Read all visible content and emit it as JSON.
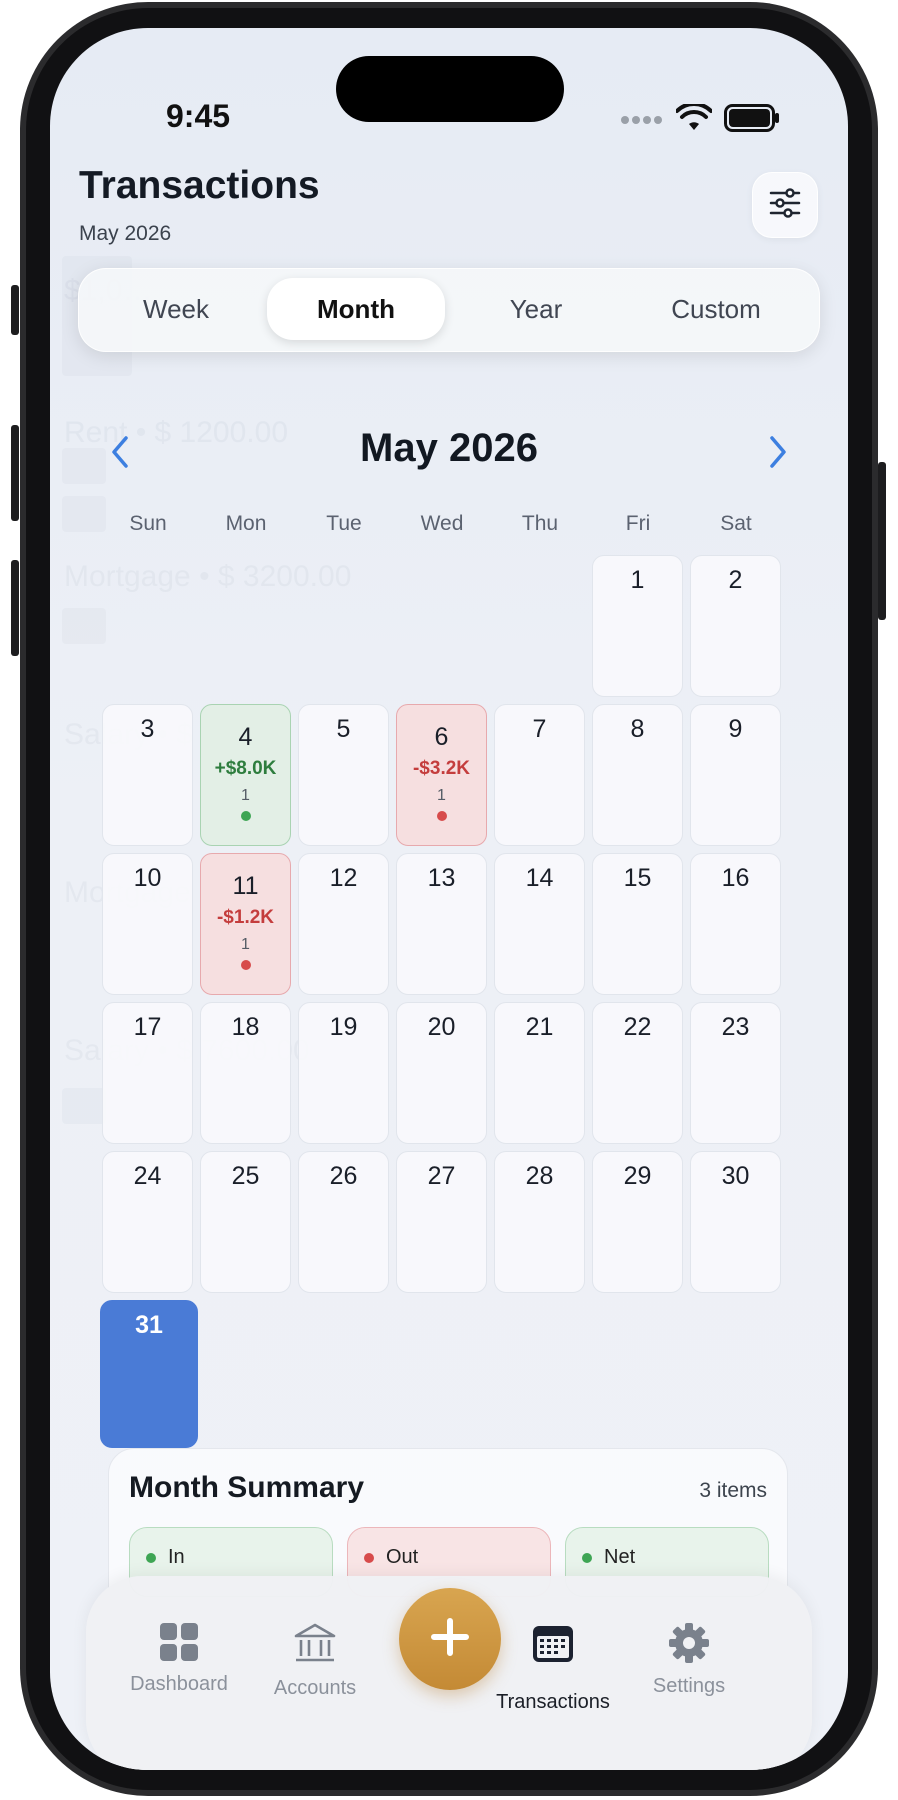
{
  "status_bar": {
    "time": "9:45"
  },
  "header": {
    "title": "Transactions",
    "subtitle": "May 2026"
  },
  "period_tabs": [
    {
      "label": "Week",
      "active": false
    },
    {
      "label": "Month",
      "active": true
    },
    {
      "label": "Year",
      "active": false
    },
    {
      "label": "Custom",
      "active": false
    }
  ],
  "background_ghost_text": [
    "$1,0…",
    "Rent • $ 1200.00",
    "Mortgage • $ 3200.00",
    "Salary • $",
    "Mortgage • $",
    "Salary • $ 7600.00"
  ],
  "calendar": {
    "title": "May 2026",
    "weekdays": [
      "Sun",
      "Mon",
      "Tue",
      "Wed",
      "Thu",
      "Fri",
      "Sat"
    ],
    "first_weekday_index": 5,
    "days_in_month": 31,
    "today": 31,
    "highlighted_days": {
      "4": {
        "type": "income",
        "amount": "+$8.0K",
        "count": "1"
      },
      "6": {
        "type": "expense",
        "amount": "-$3.2K",
        "count": "1"
      },
      "11": {
        "type": "expense",
        "amount": "-$1.2K",
        "count": "1"
      }
    }
  },
  "month_summary": {
    "title": "Month Summary",
    "count": "3 items",
    "chips": [
      {
        "label": "In",
        "color": "#3ea554",
        "bg": "#e8f3eb",
        "border": "#b8dcc0"
      },
      {
        "label": "Out",
        "color": "#d74b4b",
        "bg": "#f8e4e5",
        "border": "#ecb6ba"
      },
      {
        "label": "Net",
        "color": "#3ea554",
        "bg": "#e8f3eb",
        "border": "#b8dcc0"
      }
    ]
  },
  "tab_bar": [
    {
      "label": "Dashboard",
      "icon": "grid-icon",
      "active": false
    },
    {
      "label": "Accounts",
      "icon": "bank-icon",
      "active": false
    },
    {
      "label": "Transactions",
      "icon": "calendar-icon",
      "active": true
    },
    {
      "label": "Settings",
      "icon": "gear-icon",
      "active": false
    }
  ],
  "colors": {
    "accent": "#4a7bd6",
    "income": "#2e7d3e",
    "expense": "#c43d3d",
    "fab": "#cf9a45"
  }
}
